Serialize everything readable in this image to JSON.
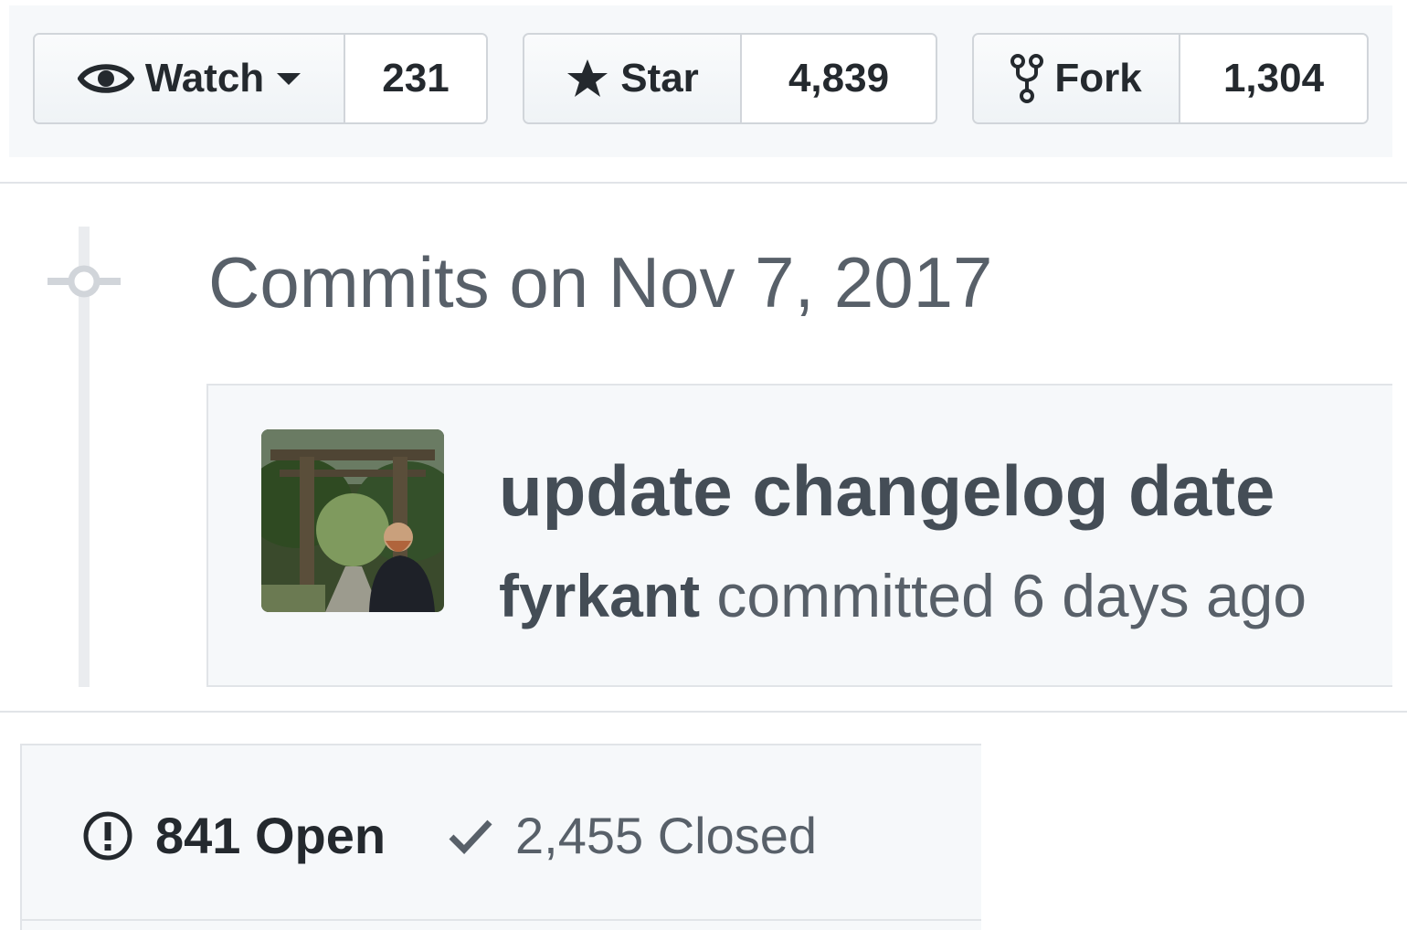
{
  "repo_actions": {
    "watch": {
      "label": "Watch",
      "count": "231",
      "icon": "eye-icon"
    },
    "star": {
      "label": "Star",
      "count": "4,839",
      "icon": "star-icon"
    },
    "fork": {
      "label": "Fork",
      "count": "1,304",
      "icon": "repo-forked-icon"
    }
  },
  "commits": {
    "group_heading": "Commits on Nov 7, 2017",
    "items": [
      {
        "title": "update changelog date",
        "author": "fyrkant",
        "action": "committed",
        "relative_time": "6 days ago"
      }
    ]
  },
  "issues": {
    "open": {
      "label": "841 Open",
      "icon": "issue-opened-icon"
    },
    "closed": {
      "label": "2,455 Closed",
      "icon": "check-icon"
    }
  },
  "colors": {
    "text": "#24292e",
    "muted": "#586069",
    "border": "#d1d5da",
    "panel_bg": "#f6f8fa"
  }
}
